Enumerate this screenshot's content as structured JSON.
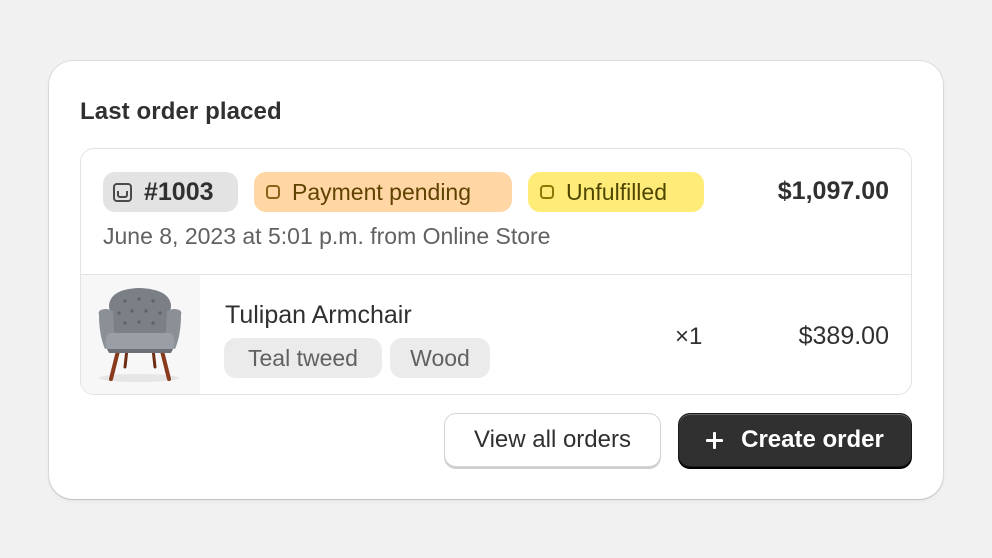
{
  "card": {
    "title": "Last order placed"
  },
  "order": {
    "number": "#1003",
    "payment_status": "Payment pending",
    "fulfillment_status": "Unfulfilled",
    "total": "$1,097.00",
    "meta": "June 8, 2023 at 5:01 p.m. from Online Store",
    "icons": {
      "order": "inbox-icon",
      "payment": "status-ring-icon",
      "fulfillment": "status-ring-icon"
    }
  },
  "line_item": {
    "name": "Tulipan Armchair",
    "variants": [
      "Teal tweed",
      "Wood"
    ],
    "quantity": "×1",
    "price": "$389.00",
    "image": "armchair-thumbnail"
  },
  "actions": {
    "view_all": "View all orders",
    "create": "Create order",
    "create_icon": "plus-icon"
  },
  "colors": {
    "payment_badge": "#ffd6a4",
    "fulfillment_badge": "#ffeb78",
    "primary_button": "#303030"
  }
}
